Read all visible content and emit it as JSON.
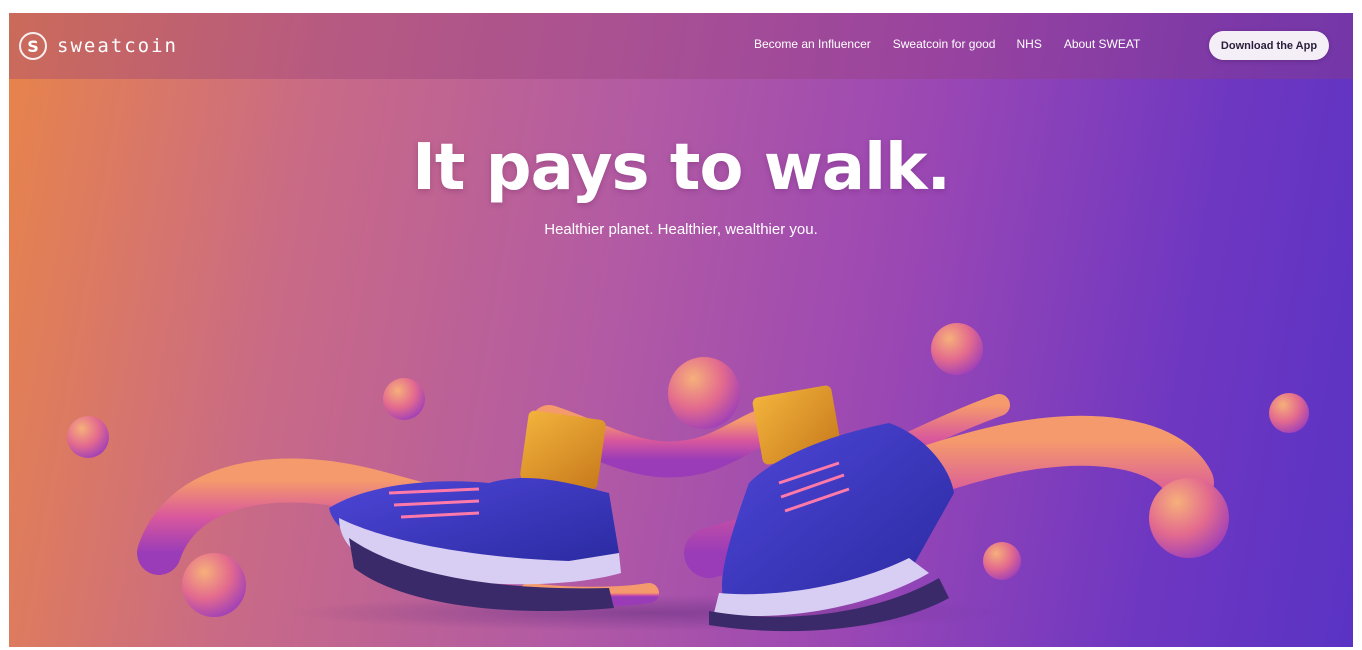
{
  "brand": {
    "logo_glyph": "S",
    "name": "sweatcoin",
    "logo_icon": "sweatcoin-logo-icon"
  },
  "nav": {
    "links": [
      {
        "label": "Become an Influencer"
      },
      {
        "label": "Sweatcoin for good"
      },
      {
        "label": "NHS"
      },
      {
        "label": "About SWEAT"
      }
    ],
    "cta_label": "Download the App"
  },
  "hero": {
    "title": "It pays to walk.",
    "subtitle": "Healthier planet. Healthier, wealthier you.",
    "illustration": "walking-sneakers-illustration"
  },
  "colors": {
    "gradient_left": "#e8844a",
    "gradient_mid": "#b25aa4",
    "gradient_right": "#5a33c4",
    "text": "#ffffff",
    "cta_bg": "#f4eef7"
  }
}
